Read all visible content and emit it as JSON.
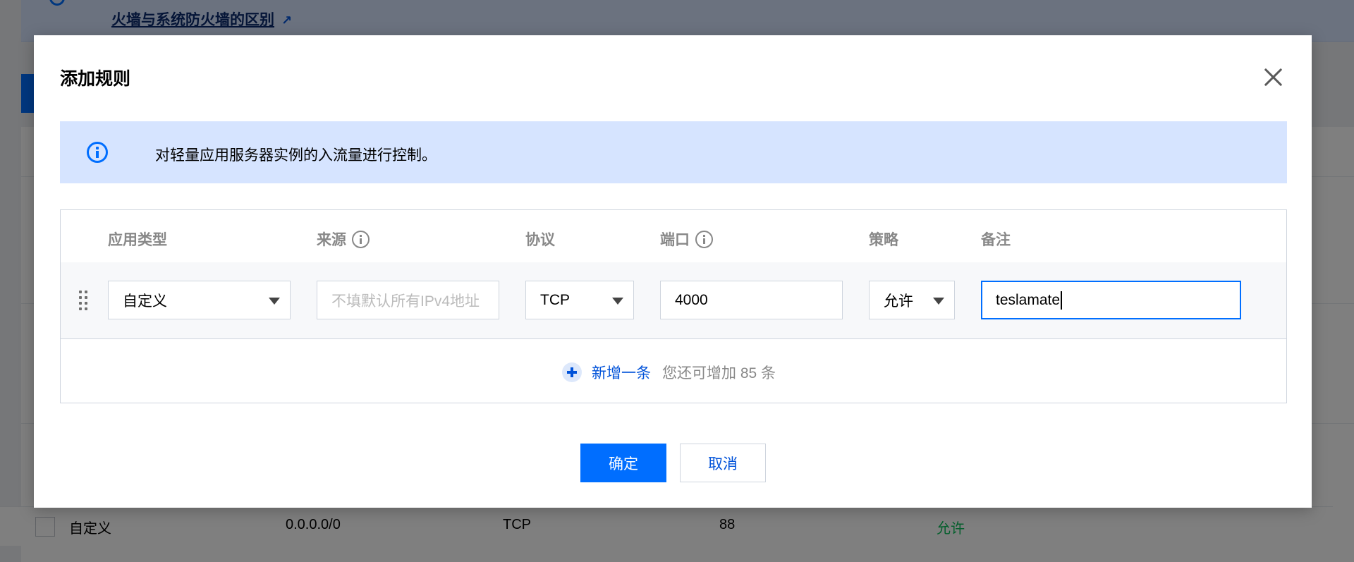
{
  "background": {
    "banner_text": "-------- ----- ---- ---- ---- ---- -------- ------- ----- --- --- ---------- --- ---- ------ --- -----",
    "banner_link": "火墙与系统防火墙的区别",
    "row": {
      "app_type": "自定义",
      "source": "0.0.0.0/0",
      "protocol": "TCP",
      "port": "88",
      "policy": "允许"
    }
  },
  "modal": {
    "title": "添加规则",
    "info_text": "对轻量应用服务器实例的入流量进行控制。",
    "columns": {
      "app_type": "应用类型",
      "source": "来源",
      "protocol": "协议",
      "port": "端口",
      "policy": "策略",
      "remark": "备注"
    },
    "rule": {
      "app_type": "自定义",
      "source_placeholder": "不填默认所有IPv4地址",
      "protocol": "TCP",
      "port": "4000",
      "policy": "允许",
      "remark": "teslamate"
    },
    "add_label": "新增一条",
    "add_hint": "您还可增加 85 条",
    "confirm_label": "确定",
    "cancel_label": "取消"
  },
  "colors": {
    "primary": "#006eff",
    "link": "#0052d9",
    "info_bg": "#d6e4ff",
    "allow": "#0abf5b"
  },
  "icons": [
    "info-icon",
    "close-icon",
    "help-icon",
    "drag-handle-icon",
    "caret-down-icon",
    "plus-icon",
    "external-link-icon"
  ]
}
